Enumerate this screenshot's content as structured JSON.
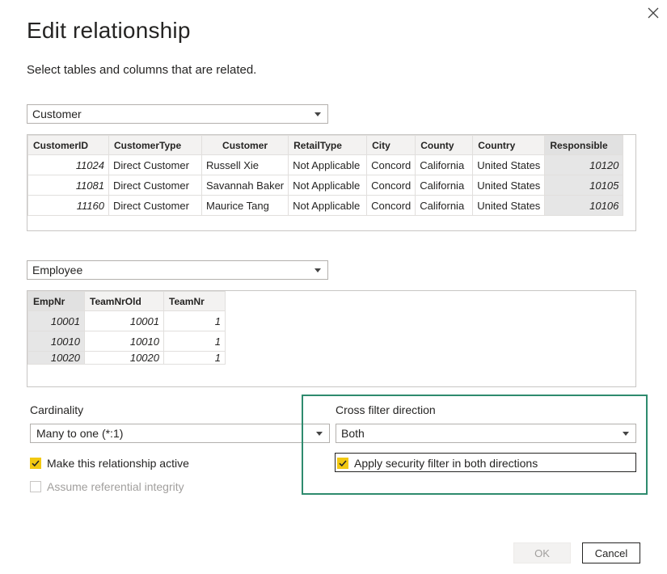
{
  "dialog": {
    "title": "Edit relationship",
    "subtitle": "Select tables and columns that are related."
  },
  "table1": {
    "selected": "Customer",
    "columns": [
      "CustomerID",
      "CustomerType",
      "Customer",
      "RetailType",
      "City",
      "County",
      "Country",
      "Responsible"
    ],
    "rows": [
      [
        "11024",
        "Direct Customer",
        "Russell Xie",
        "Not Applicable",
        "Concord",
        "California",
        "United States",
        "10120"
      ],
      [
        "11081",
        "Direct Customer",
        "Savannah Baker",
        "Not Applicable",
        "Concord",
        "California",
        "United States",
        "10105"
      ],
      [
        "11160",
        "Direct Customer",
        "Maurice Tang",
        "Not Applicable",
        "Concord",
        "California",
        "United States",
        "10106"
      ]
    ]
  },
  "table2": {
    "selected": "Employee",
    "columns": [
      "EmpNr",
      "TeamNrOld",
      "TeamNr"
    ],
    "rows": [
      [
        "10001",
        "10001",
        "1"
      ],
      [
        "10010",
        "10010",
        "1"
      ],
      [
        "10020",
        "10020",
        "1"
      ]
    ]
  },
  "cardinality": {
    "label": "Cardinality",
    "value": "Many to one (*:1)"
  },
  "cross_filter": {
    "label": "Cross filter direction",
    "value": "Both"
  },
  "options": {
    "make_active": {
      "label": "Make this relationship active",
      "checked": true
    },
    "referential_integrity": {
      "label": "Assume referential integrity",
      "checked": false,
      "disabled": true
    },
    "security_filter": {
      "label": "Apply security filter in both directions",
      "checked": true
    }
  },
  "buttons": {
    "ok": "OK",
    "cancel": "Cancel"
  },
  "colors": {
    "checkbox_accent": "#f2c811",
    "highlight_border": "#2e8b6e"
  }
}
